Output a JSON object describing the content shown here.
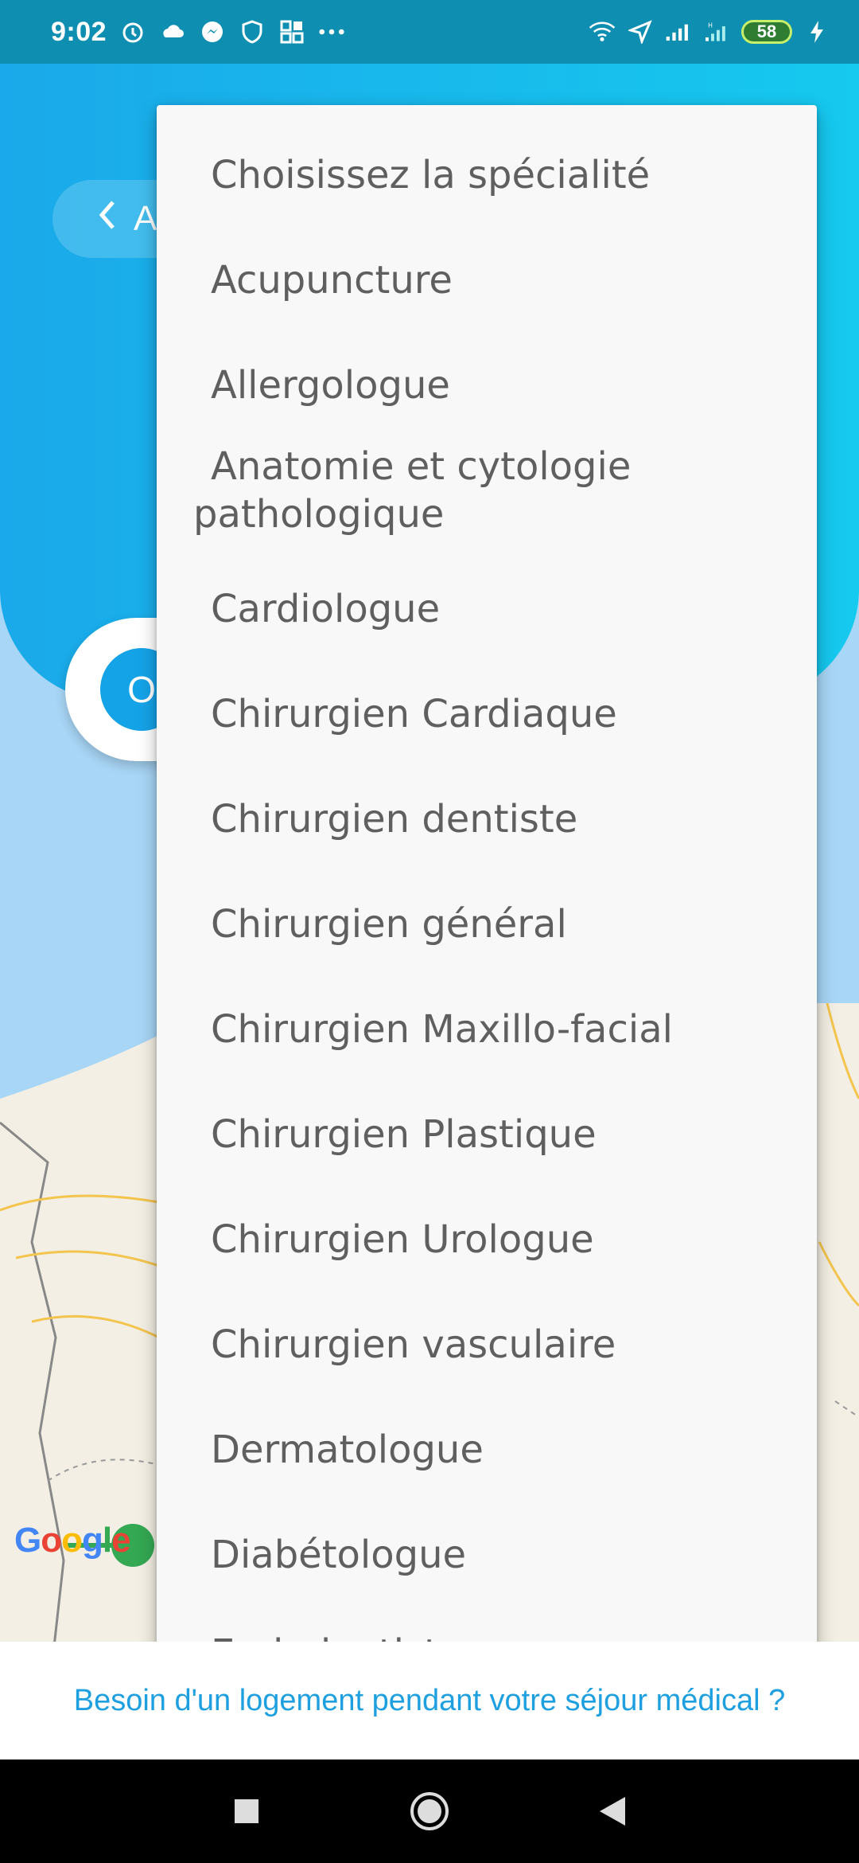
{
  "status_bar": {
    "time": "9:02",
    "battery": "58",
    "icons": [
      "alarm-icon",
      "cloud-icon",
      "messenger-icon",
      "shield-icon",
      "grid-icon",
      "more-icon",
      "wifi-icon",
      "location-icon",
      "signal-icon",
      "signal-h-icon",
      "charging-icon"
    ]
  },
  "background": {
    "back_label": "A",
    "search_label": "O",
    "map_logo": "Google"
  },
  "dropdown": {
    "items": [
      "Choisissez la spécialité",
      "Acupuncture",
      "Allergologue",
      "Anatomie et cytologie pathologique",
      "Cardiologue",
      "Chirurgien Cardiaque",
      "Chirurgien dentiste",
      "Chirurgien général",
      "Chirurgien Maxillo-facial",
      "Chirurgien Plastique",
      "Chirurgien Urologue",
      "Chirurgien vasculaire",
      "Dermatologue",
      "Diabétologue",
      "Endodontiste"
    ]
  },
  "footer": {
    "link": "Besoin d'un logement pendant votre séjour médical ?"
  },
  "colors": {
    "status_bar": "#0e8fb1",
    "header_blue": "#1aa9ea",
    "menu_text": "#5f5f5f",
    "link": "#1ea0e0",
    "map_green": "#34a853"
  }
}
